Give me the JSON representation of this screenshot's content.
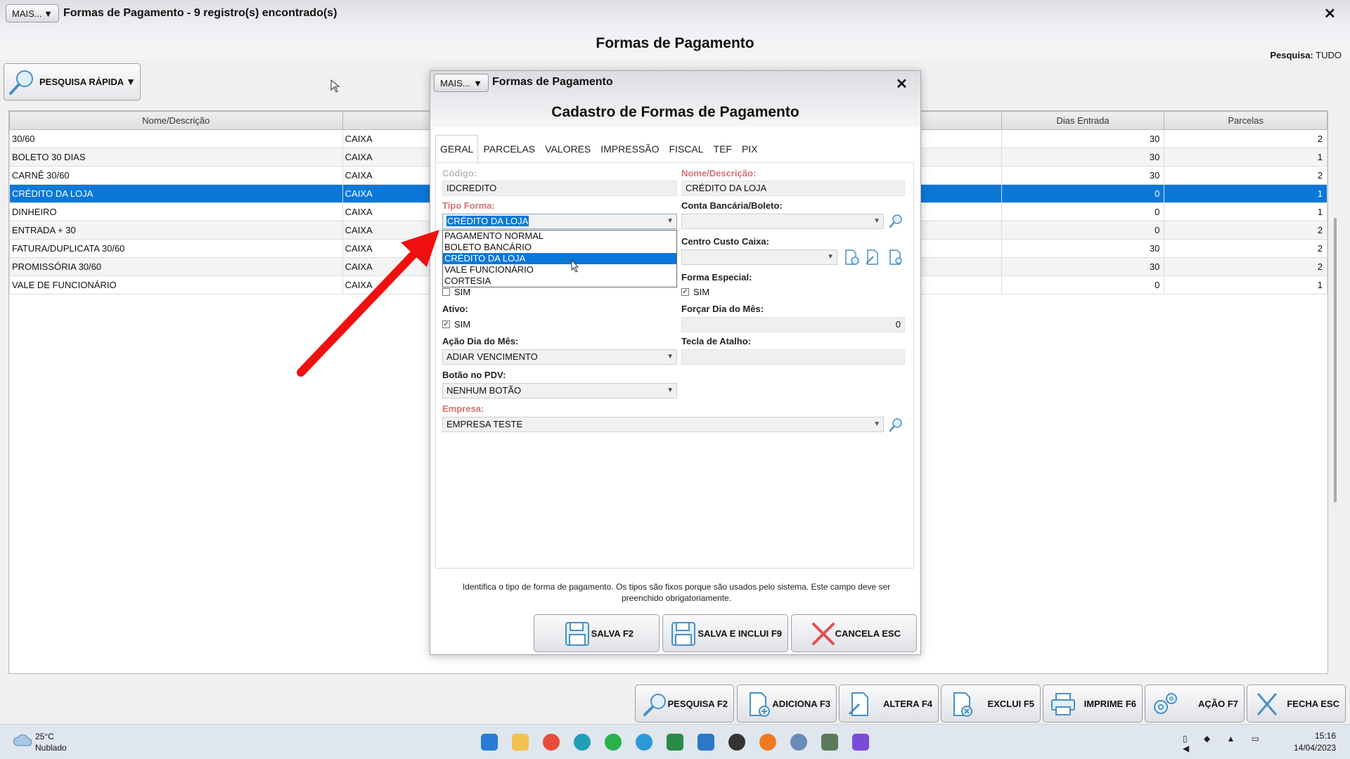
{
  "window": {
    "mais_label": "MAIS...",
    "title": "Formas de Pagamento - 9 registro(s) encontrado(s)",
    "close": "✕",
    "page_title": "Formas de Pagamento",
    "search_mode_label": "Pesquisa:",
    "search_mode_value": "TUDO",
    "quick_search_label": "PESQUISA RÁPIDA"
  },
  "grid": {
    "headers": {
      "name": "Nome/Descrição",
      "dias": "Dias Entrada",
      "parcelas": "Parcelas"
    },
    "rows": [
      {
        "name": "30/60",
        "tipo": "CAIXA",
        "dias": "30",
        "parcelas": "2"
      },
      {
        "name": "BOLETO 30 DIAS",
        "tipo": "CAIXA",
        "dias": "30",
        "parcelas": "1"
      },
      {
        "name": "CARNÊ 30/60",
        "tipo": "CAIXA",
        "dias": "30",
        "parcelas": "2"
      },
      {
        "name": "CRÉDITO DA LOJA",
        "tipo": "CAIXA",
        "dias": "0",
        "parcelas": "1"
      },
      {
        "name": "DINHEIRO",
        "tipo": "CAIXA",
        "dias": "0",
        "parcelas": "1"
      },
      {
        "name": "ENTRADA + 30",
        "tipo": "CAIXA",
        "dias": "0",
        "parcelas": "2"
      },
      {
        "name": "FATURA/DUPLICATA 30/60",
        "tipo": "CAIXA",
        "dias": "30",
        "parcelas": "2"
      },
      {
        "name": "PROMISSÓRIA 30/60",
        "tipo": "CAIXA",
        "dias": "30",
        "parcelas": "2"
      },
      {
        "name": "VALE DE FUNCIONÁRIO",
        "tipo": "CAIXA",
        "dias": "0",
        "parcelas": "1"
      }
    ]
  },
  "bottom_buttons": {
    "pesquisa": "PESQUISA F2",
    "adiciona": "ADICIONA F3",
    "altera": "ALTERA F4",
    "exclui": "EXCLUI F5",
    "imprime": "IMPRIME F6",
    "acao": "AÇÃO F7",
    "fecha": "FECHA ESC"
  },
  "modal": {
    "mais_label": "MAIS...",
    "title": "Formas de Pagamento",
    "close": "✕",
    "heading": "Cadastro de Formas de Pagamento",
    "tabs": [
      "GERAL",
      "PARCELAS",
      "VALORES",
      "IMPRESSÃO",
      "FISCAL",
      "TEF",
      "PIX"
    ],
    "fields": {
      "codigo_label": "Código:",
      "codigo_value": "IDCREDITO",
      "nome_label": "Nome/Descrição:",
      "nome_value": "CRÉDITO DA LOJA",
      "tipo_label": "Tipo Forma:",
      "tipo_value": "CRÉDITO DA LOJA",
      "conta_label": "Conta Bancária/Boleto:",
      "centro_label": "Centro Custo Caixa:",
      "especial_label": "Forma Especial:",
      "sim": "SIM",
      "ativo_label": "Ativo:",
      "forcar_label": "Forçar Dia do Mês:",
      "forcar_value": "0",
      "acao_label": "Ação Dia do Mês:",
      "acao_value": "ADIAR VENCIMENTO",
      "tecla_label": "Tecla de Atalho:",
      "botao_label": "Botão no PDV:",
      "botao_value": "NENHUM BOTÃO",
      "empresa_label": "Empresa:",
      "empresa_value": "EMPRESA TESTE"
    },
    "dropdown_options": [
      "PAGAMENTO NORMAL",
      "BOLETO BANCÁRIO",
      "CRÉDITO DA LOJA",
      "VALE FUNCIONÁRIO",
      "CORTESIA"
    ],
    "hint": "Identifica o tipo de forma de pagamento. Os tipos são fixos porque são usados pelo sistema. Este campo deve ser preenchido obrigatoriamente.",
    "buttons": {
      "salva": "SALVA F2",
      "salva_inclui": "SALVA E INCLUI F9",
      "cancela": "CANCELA ESC"
    }
  },
  "taskbar": {
    "temp": "25°C",
    "weather": "Nublado",
    "time": "15:16",
    "date": "14/04/2023"
  },
  "colors": {
    "selection": "#0b78d7",
    "arrow": "#f01010",
    "required_label": "#d87070"
  }
}
